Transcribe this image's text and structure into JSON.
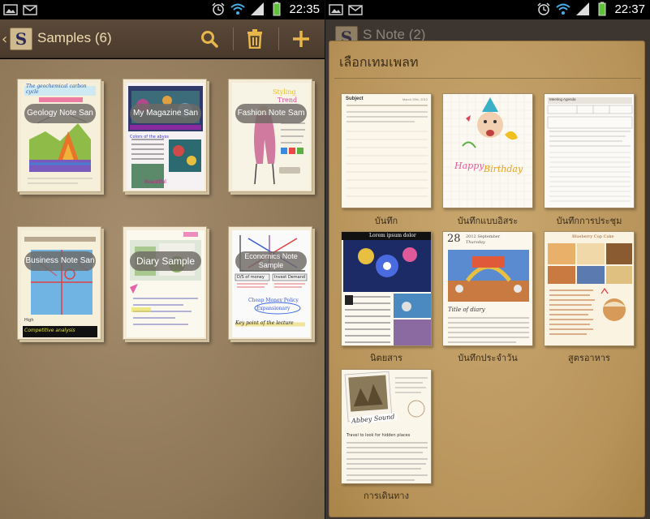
{
  "left": {
    "status": {
      "time": "22:35"
    },
    "actionbar": {
      "title": "Samples (6)"
    },
    "notes": [
      {
        "label": "Geology Note San"
      },
      {
        "label": "My Magazine San"
      },
      {
        "label": "Fashion Note Sam"
      },
      {
        "label": "Business Note San"
      },
      {
        "label": "Diary Sample"
      },
      {
        "label": "Economics Note Sample"
      }
    ],
    "thumb_text": {
      "geology_heading": "The geochemical carbon cycle",
      "magazine_heading": "Colors of the abyss",
      "economics_col1": "Cheap Money Policy",
      "economics_col2": "Expansionary",
      "economics_footer": "Key point of the lecture",
      "business_footer": "Competitive analysis",
      "economics_left_head": "D/S of money",
      "economics_right_head": "Invest Demand"
    }
  },
  "right": {
    "status": {
      "time": "22:37"
    },
    "actionbar": {
      "title": "S Note (2)"
    },
    "dialog": {
      "title": "เลือกเทมเพลท",
      "templates": [
        {
          "label": "บันทึก",
          "kind": "memo",
          "heading": "Subject",
          "date": "March 29th, 2012"
        },
        {
          "label": "บันทึกแบบอิสระ",
          "kind": "birthday",
          "heading": "Happy Birthday"
        },
        {
          "label": "บันทึกการประชุม",
          "kind": "meeting",
          "heading": "Meeting Agenda"
        },
        {
          "label": "นิตยสาร",
          "kind": "magazine",
          "heading": "Lorem ipsum dolor"
        },
        {
          "label": "บันทึกประจำวัน",
          "kind": "diary",
          "heading": "Title of diary",
          "day": "28",
          "date": "2012 September",
          "weekday": "Thursday"
        },
        {
          "label": "สูตรอาหาร",
          "kind": "recipe",
          "heading": "Blueberry Cup Cake"
        },
        {
          "label": "การเดินทาง",
          "kind": "travel",
          "heading": "Travel to look for hidden places",
          "stamp": "Abbey Sound"
        }
      ]
    }
  },
  "colors": {
    "actionbar": "#4f3f30",
    "left_bg": "#9a8262",
    "dialog_bg": "#c09c62",
    "icon_accent": "#e8b64a"
  }
}
